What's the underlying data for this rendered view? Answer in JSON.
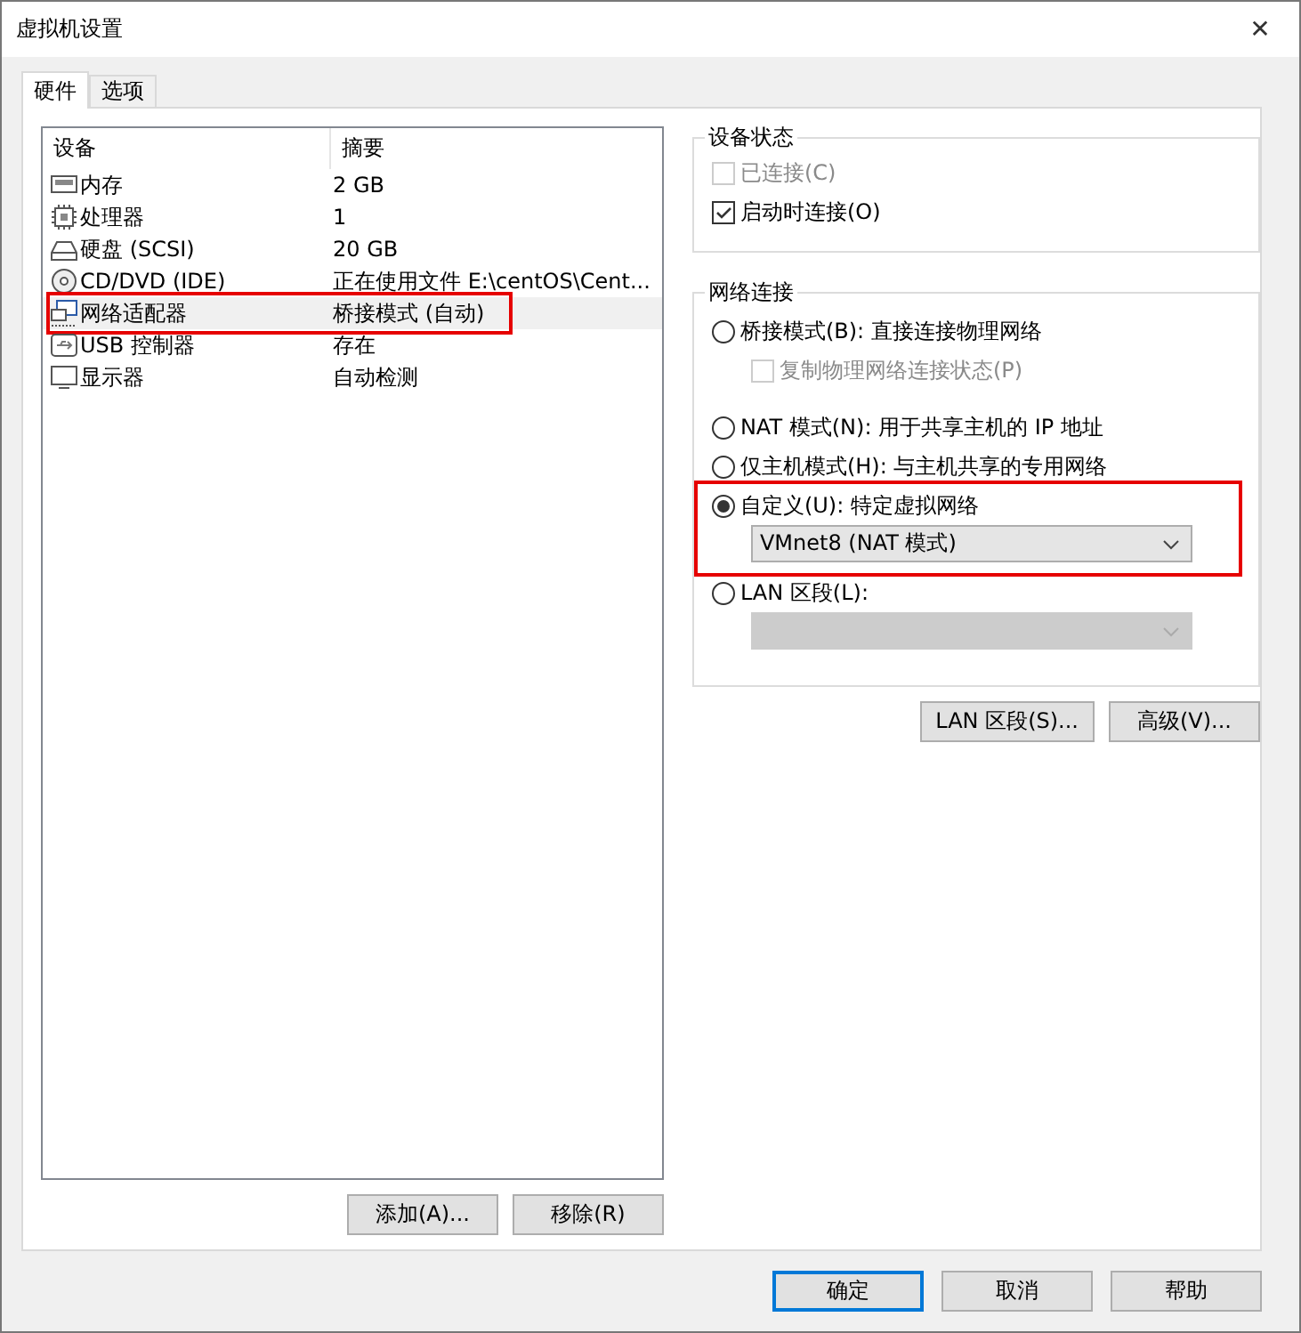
{
  "window": {
    "title": "虚拟机设置",
    "close": "✕"
  },
  "tabs": [
    {
      "label": "硬件",
      "selected": true
    },
    {
      "label": "选项",
      "selected": false
    }
  ],
  "device_list": {
    "columns": [
      "设备",
      "摘要"
    ],
    "rows": [
      {
        "kind": "memory",
        "name": "内存",
        "summary": "2 GB",
        "selected": false,
        "annotated": false
      },
      {
        "kind": "cpu",
        "name": "处理器",
        "summary": "1",
        "selected": false,
        "annotated": false
      },
      {
        "kind": "disk",
        "name": "硬盘 (SCSI)",
        "summary": "20 GB",
        "selected": false,
        "annotated": false
      },
      {
        "kind": "cdrom",
        "name": "CD/DVD (IDE)",
        "summary": "正在使用文件 E:\\centOS\\Cent...",
        "selected": false,
        "annotated": false
      },
      {
        "kind": "network",
        "name": "网络适配器",
        "summary": "桥接模式 (自动)",
        "selected": true,
        "annotated": true
      },
      {
        "kind": "usb",
        "name": "USB 控制器",
        "summary": "存在",
        "selected": false,
        "annotated": false
      },
      {
        "kind": "monitor",
        "name": "显示器",
        "summary": "自动检测",
        "selected": false,
        "annotated": false
      }
    ],
    "buttons": [
      "添加(A)...",
      "移除(R)"
    ]
  },
  "device_status": {
    "title": "设备状态",
    "options": [
      {
        "label": "已连接(C)",
        "checked": false,
        "disabled": true
      },
      {
        "label": "启动时连接(O)",
        "checked": true,
        "disabled": false
      }
    ]
  },
  "network_connection": {
    "title": "网络连接",
    "options": [
      {
        "label": "桥接模式(B): 直接连接物理网络",
        "selected": false,
        "annotated": false,
        "sub": {
          "kind": "checkbox",
          "label": "复制物理网络连接状态(P)",
          "checked": false,
          "disabled": true
        }
      },
      {
        "label": "NAT 模式(N): 用于共享主机的 IP 地址",
        "selected": false,
        "annotated": false
      },
      {
        "label": "仅主机模式(H): 与主机共享的专用网络",
        "selected": false,
        "annotated": false
      },
      {
        "label": "自定义(U): 特定虚拟网络",
        "selected": true,
        "annotated": true,
        "sub": {
          "kind": "select",
          "value": "VMnet8 (NAT 模式)",
          "disabled": false
        }
      },
      {
        "label": "LAN 区段(L):",
        "selected": false,
        "annotated": false,
        "sub": {
          "kind": "select",
          "disabled": true
        }
      }
    ]
  },
  "panel_buttons": [
    "LAN 区段(S)...",
    "高级(V)..."
  ],
  "dialog_buttons": [
    {
      "label": "确定",
      "default": true
    },
    {
      "label": "取消",
      "default": false
    },
    {
      "label": "帮助",
      "default": false
    }
  ]
}
